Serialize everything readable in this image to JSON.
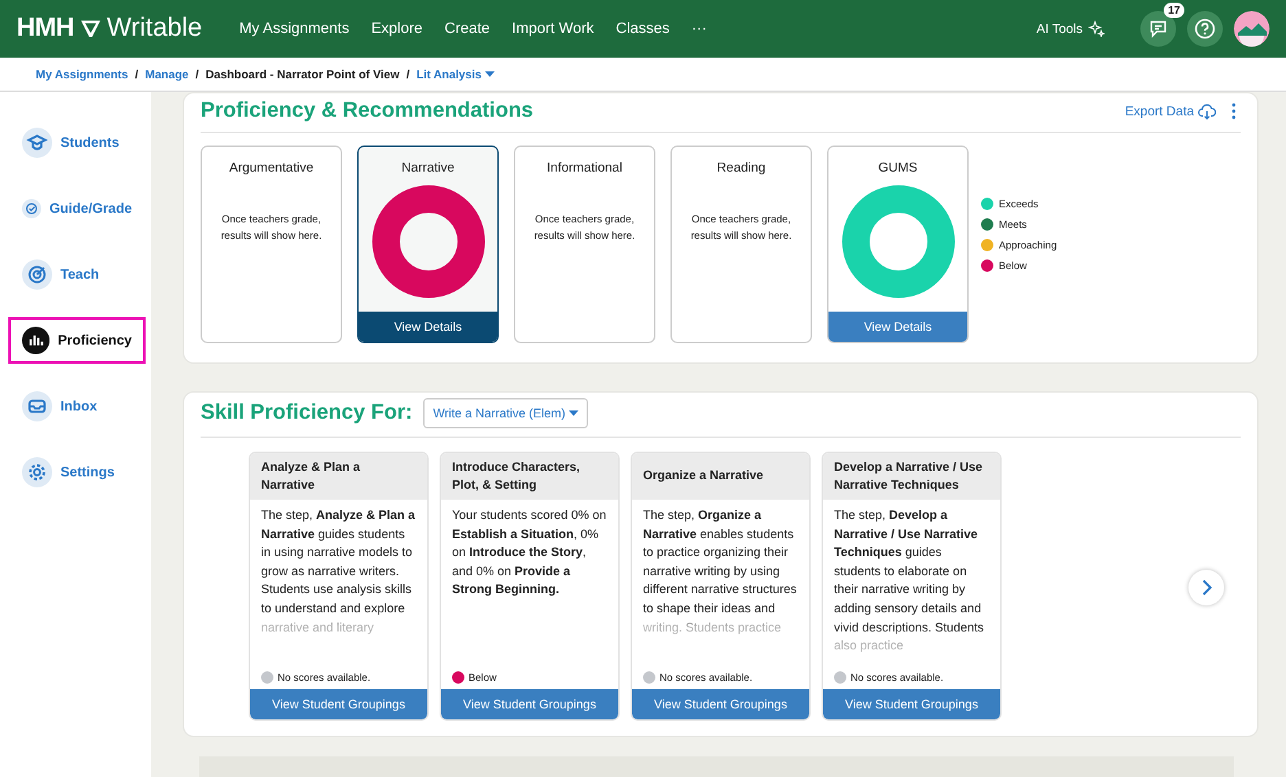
{
  "topbar": {
    "logo": "HMH",
    "product": "Writable",
    "nav": [
      {
        "label": "My Assignments"
      },
      {
        "label": "Explore"
      },
      {
        "label": "Create"
      },
      {
        "label": "Import Work"
      },
      {
        "label": "Classes"
      },
      {
        "label": "···"
      }
    ],
    "ai_tools": "AI Tools",
    "badge": "17"
  },
  "breadcrumb": {
    "separator": "/",
    "items": [
      {
        "label": "My Assignments",
        "kind": "link"
      },
      {
        "label": "Manage",
        "kind": "link"
      },
      {
        "label": "Dashboard - Narrator Point of View",
        "kind": "text"
      },
      {
        "label": "Lit Analysis",
        "kind": "dropdown"
      }
    ]
  },
  "sidebar": {
    "items": [
      {
        "label": "Students",
        "selected": false
      },
      {
        "label": "Guide/Grade",
        "selected": false
      },
      {
        "label": "Teach",
        "selected": false
      },
      {
        "label": "Proficiency",
        "selected": true
      },
      {
        "label": "Inbox",
        "selected": false
      },
      {
        "label": "Settings",
        "selected": false
      }
    ]
  },
  "proficiency": {
    "title": "Proficiency & Recommendations",
    "export": "Export Data",
    "tiles": [
      {
        "title": "Argumentative",
        "kind": "empty",
        "message": "Once teachers grade, results will show here.",
        "selected": false
      },
      {
        "title": "Narrative",
        "kind": "donut",
        "color": "#d8085e",
        "button": "View Details",
        "selected": true
      },
      {
        "title": "Informational",
        "kind": "empty",
        "message": "Once teachers grade, results will show here.",
        "selected": false
      },
      {
        "title": "Reading",
        "kind": "empty",
        "message": "Once teachers grade, results will show here.",
        "selected": false
      },
      {
        "title": "GUMS",
        "kind": "donut",
        "color": "#1ad3ab",
        "button": "View Details",
        "selected": false
      }
    ],
    "legend": [
      {
        "label": "Exceeds",
        "color": "#1ad3ab"
      },
      {
        "label": "Meets",
        "color": "#1f7d4f"
      },
      {
        "label": "Approaching",
        "color": "#f0b323"
      },
      {
        "label": "Below",
        "color": "#d8085e"
      }
    ]
  },
  "skills": {
    "title": "Skill Proficiency For:",
    "dropdown": "Write a Narrative (Elem)",
    "cards": [
      {
        "title": "Analyze & Plan a Narrative",
        "text": "The step, **Analyze & Plan a Narrative** guides students in using narrative models to grow as narrative writers. Students use analysis skills to understand and explore narrative and literary",
        "faded": true,
        "status": "No scores available.",
        "color": "#c4c7cc",
        "button": "View Student Groupings"
      },
      {
        "title": "Introduce Characters, Plot, & Setting",
        "text": "Your students scored 0% on **Establish a Situation**, 0% on **Introduce the Story**, and 0% on **Provide a Strong Beginning.**",
        "faded": false,
        "status": "Below",
        "color": "#d8085e",
        "button": "View Student Groupings"
      },
      {
        "title": "Organize a Narrative",
        "text": "The step, **Organize a Narrative** enables students to practice organizing their narrative writing by using different narrative structures to shape their ideas and writing. Students practice",
        "faded": true,
        "status": "No scores available.",
        "color": "#c4c7cc",
        "button": "View Student Groupings"
      },
      {
        "title": "Develop a Narrative / Use Narrative Techniques",
        "text": "The step, **Develop a Narrative / Use Narrative Techniques** guides students to elaborate on their narrative writing by adding sensory details and vivid descriptions. Students also practice",
        "faded": true,
        "status": "No scores available.",
        "color": "#c4c7cc",
        "button": "View Student Groupings"
      }
    ]
  }
}
